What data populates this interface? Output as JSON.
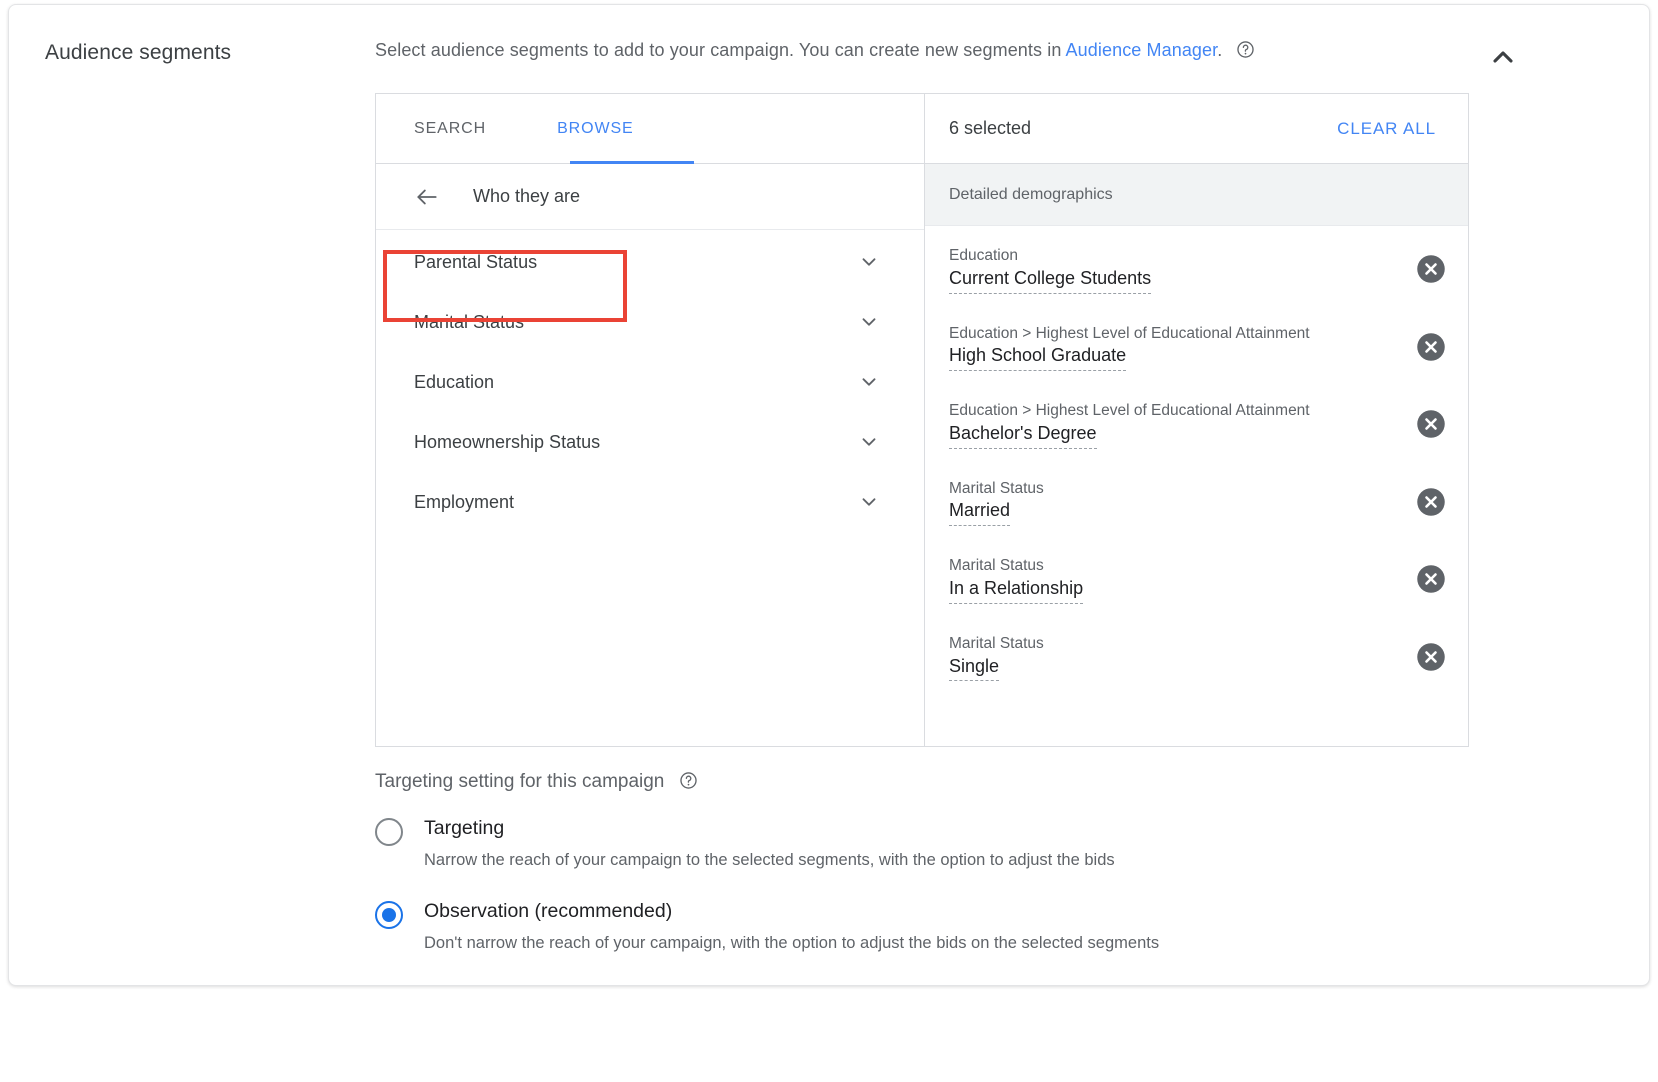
{
  "section": {
    "title": "Audience segments",
    "description_prefix": "Select audience segments to add to your campaign. You can create new segments in ",
    "description_link": "Audience Manager",
    "description_suffix": ".",
    "help_icon": "help-circle-icon",
    "collapse_icon": "chevron-up-icon"
  },
  "picker": {
    "tabs": [
      {
        "label": "SEARCH",
        "active": false
      },
      {
        "label": "BROWSE",
        "active": true
      }
    ],
    "breadcrumb": {
      "back_icon": "arrow-left-icon",
      "label": "Who they are",
      "highlighted": true,
      "highlight_color": "#ea4335"
    },
    "categories": [
      {
        "label": "Parental Status",
        "expand_icon": "chevron-down-icon"
      },
      {
        "label": "Marital Status",
        "expand_icon": "chevron-down-icon"
      },
      {
        "label": "Education",
        "expand_icon": "chevron-down-icon"
      },
      {
        "label": "Homeownership Status",
        "expand_icon": "chevron-down-icon"
      },
      {
        "label": "Employment",
        "expand_icon": "chevron-down-icon"
      }
    ]
  },
  "selected_panel": {
    "count_label": "6 selected",
    "clear_all_label": "CLEAR ALL",
    "group_label": "Detailed demographics",
    "items": [
      {
        "path": "Education",
        "name": "Current College Students",
        "remove_icon": "close-circle-icon"
      },
      {
        "path": "Education > Highest Level of Educational Attainment",
        "name": "High School Graduate",
        "remove_icon": "close-circle-icon"
      },
      {
        "path": "Education > Highest Level of Educational Attainment",
        "name": "Bachelor's Degree",
        "remove_icon": "close-circle-icon"
      },
      {
        "path": "Marital Status",
        "name": "Married",
        "remove_icon": "close-circle-icon"
      },
      {
        "path": "Marital Status",
        "name": "In a Relationship",
        "remove_icon": "close-circle-icon"
      },
      {
        "path": "Marital Status",
        "name": "Single",
        "remove_icon": "close-circle-icon"
      }
    ]
  },
  "targeting": {
    "title": "Targeting setting for this campaign",
    "help_icon": "help-circle-icon",
    "options": [
      {
        "label": "Targeting",
        "description": "Narrow the reach of your campaign to the selected segments, with the option to adjust the bids",
        "selected": false
      },
      {
        "label": "Observation (recommended)",
        "description": "Don't narrow the reach of your campaign, with the option to adjust the bids on the selected segments",
        "selected": true
      }
    ]
  },
  "colors": {
    "accent": "#4285f4",
    "radio_accent": "#1a73e8",
    "highlight": "#ea4335",
    "text_primary": "#202124",
    "text_secondary": "#5f6368"
  }
}
